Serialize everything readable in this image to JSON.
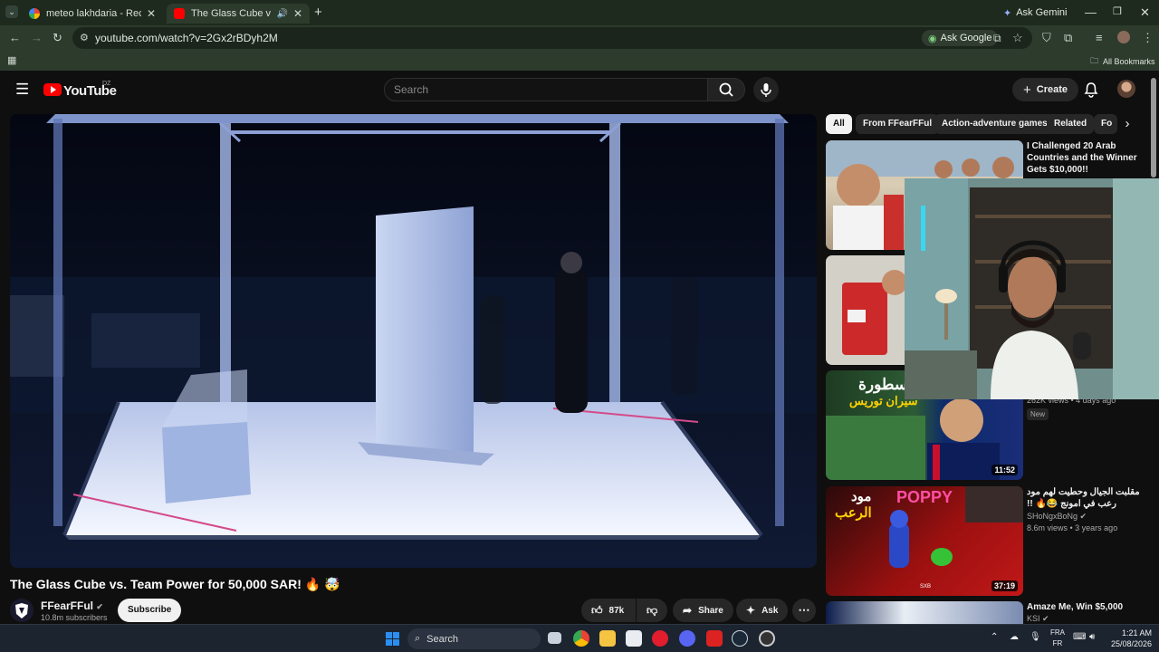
{
  "browser": {
    "tabs": [
      {
        "title": "meteo lakhdaria - Recherche G"
      },
      {
        "title": "The Glass Cube vs. Team Po"
      }
    ],
    "ask_gemini": "Ask Gemini",
    "url": "youtube.com/watch?v=2Gx2rBDyh2M",
    "ask_google": "Ask Google",
    "all_bookmarks": "All Bookmarks"
  },
  "youtube": {
    "logo_text": "YouTube",
    "country_code": "DZ",
    "search_placeholder": "Search",
    "create_label": "Create"
  },
  "video": {
    "title": "The Glass Cube vs. Team Power for 50,000 SAR! 🔥 🤯",
    "channel": "FFearFFul",
    "subscribers": "10.8m subscribers",
    "subscribe_label": "Subscribe",
    "likes": "87k",
    "share_label": "Share",
    "ask_label": "Ask"
  },
  "chips": [
    "All",
    "From FFearFFul",
    "Action-adventure games",
    "Related",
    "Fo"
  ],
  "recommended": [
    {
      "title": "I Challenged 20 Arab Countries and the Winner Gets $10,000!!",
      "meta": "",
      "duration": ""
    },
    {
      "title": "",
      "meta": "",
      "duration": ""
    },
    {
      "title": "",
      "meta": "262K views • 4 days ago",
      "badge": "New",
      "duration": "11:52",
      "thumb_text_1": "لأسطورة",
      "thumb_text_2": "سيران توريس"
    },
    {
      "title": "مقلبت الجيال وحطيت لهم مود رعب في امونج 😂🔥 !!",
      "channel": "SHoNgxBoNg",
      "meta": "8.6m views • 3 years ago",
      "duration": "37:19",
      "thumb_text_1": "مود",
      "thumb_text_2": "الرعب",
      "thumb_text_3": "POPPY",
      "thumb_text_4": "SXB"
    },
    {
      "title": "Amaze Me, Win $5,000",
      "channel": "KSI",
      "meta": "",
      "duration": ""
    }
  ],
  "taskbar": {
    "search_label": "Search",
    "lang_1": "FRA",
    "lang_2": "FR",
    "time": "1:21 AM",
    "date": "25/08/2026"
  },
  "colors": {
    "brand_red": "#ff0000",
    "background": "#0f0f0f",
    "chip_bg": "#272727"
  }
}
